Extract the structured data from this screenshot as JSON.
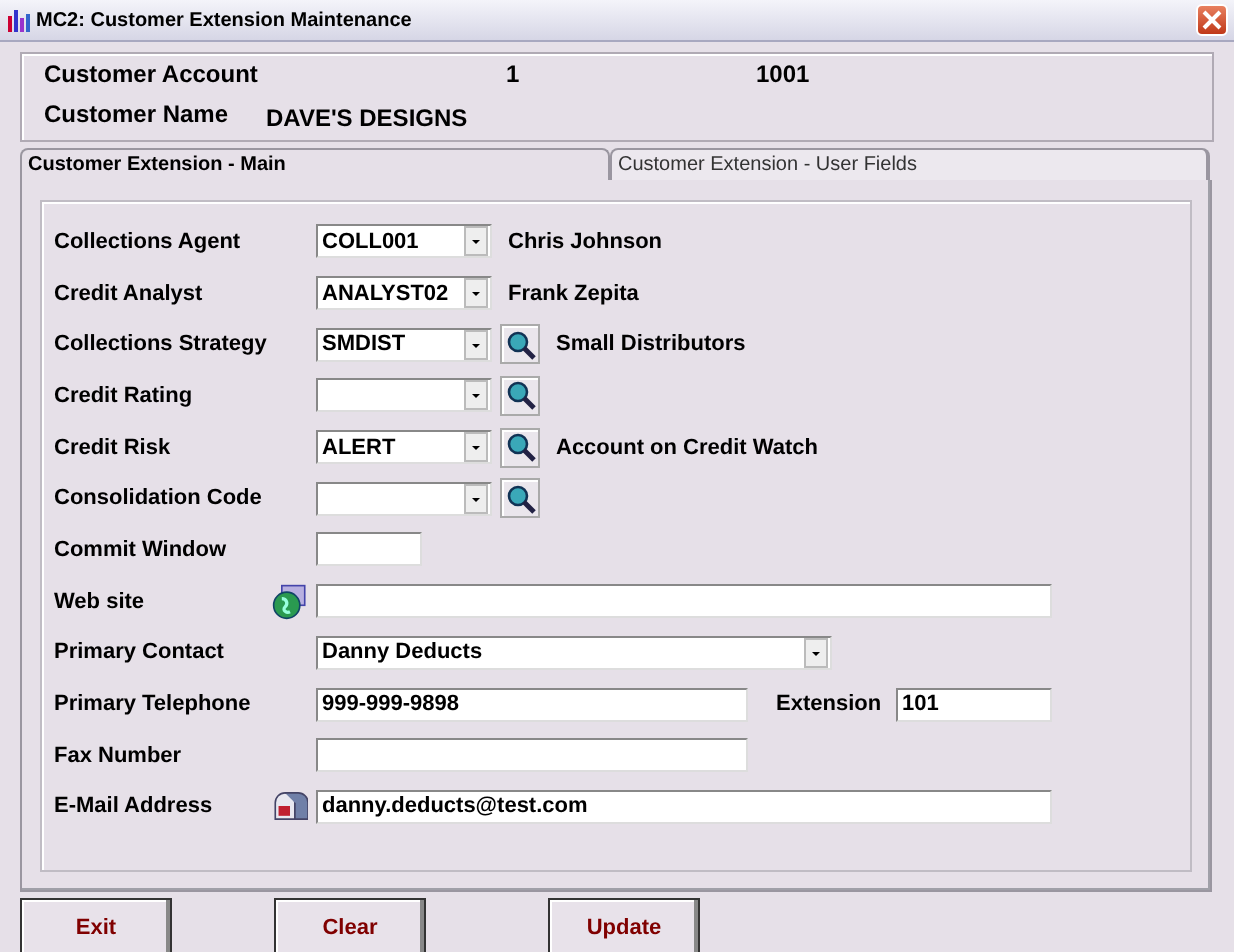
{
  "window": {
    "title": "MC2: Customer Extension Maintenance"
  },
  "header": {
    "account_label": "Customer Account",
    "account_values": [
      "1",
      "1001"
    ],
    "name_label": "Customer Name",
    "name_value": "DAVE'S DESIGNS"
  },
  "tabs": [
    {
      "label": "Customer Extension - Main",
      "selected": true
    },
    {
      "label": "Customer Extension - User Fields",
      "selected": false
    }
  ],
  "fields": [
    {
      "label": "Collections Agent",
      "kind": "combo",
      "value": "COLL001",
      "lookup": false,
      "description": "Chris Johnson"
    },
    {
      "label": "Credit Analyst",
      "kind": "combo",
      "value": "ANALYST02",
      "lookup": false,
      "description": "Frank Zepita"
    },
    {
      "label": "Collections Strategy",
      "kind": "combo",
      "value": "SMDIST",
      "lookup": true,
      "description": "Small Distributors"
    },
    {
      "label": "Credit Rating",
      "kind": "combo",
      "lookup": true
    },
    {
      "label": "Credit Risk",
      "kind": "combo",
      "value": "ALERT",
      "lookup": true,
      "description": "Account on Credit Watch"
    },
    {
      "label": "Consolidation Code",
      "kind": "combo",
      "lookup": true
    },
    {
      "label": "Commit Window",
      "kind": "short"
    },
    {
      "label": "Web site",
      "kind": "web"
    },
    {
      "label": "Primary Contact",
      "kind": "contact",
      "value": "Danny Deducts"
    },
    {
      "label": "Primary Telephone",
      "kind": "phone",
      "value": "999-999-9898",
      "extension_label": "Extension",
      "extension_value": "101"
    },
    {
      "label": "Fax Number",
      "kind": "phone"
    },
    {
      "label": "E-Mail Address",
      "kind": "email",
      "value": "danny.deducts@test.com"
    }
  ],
  "buttons": [
    "Exit",
    "Clear",
    "Update"
  ]
}
